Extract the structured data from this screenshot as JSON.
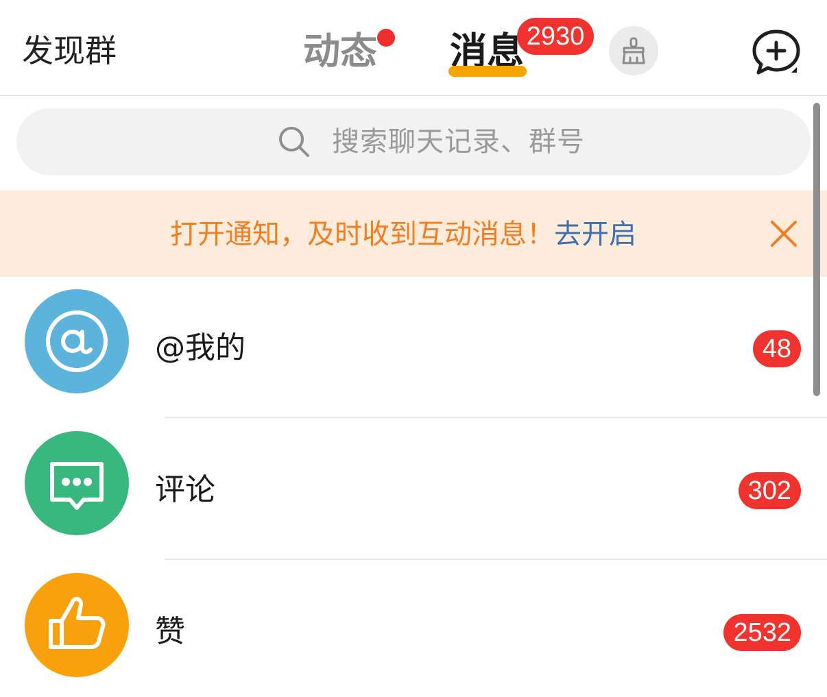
{
  "header": {
    "discover_group": "发现群",
    "tabs": [
      {
        "label": "动态",
        "has_dot": true
      },
      {
        "label": "消息",
        "active": true,
        "badge": "2930"
      }
    ],
    "clean_icon": "broom-icon",
    "new_chat_icon": "chat-plus-icon"
  },
  "search": {
    "placeholder": "搜索聊天记录、群号",
    "icon": "search-icon"
  },
  "banner": {
    "message": "打开通知，及时收到互动消息！",
    "link": "去开启",
    "close_icon": "close-icon"
  },
  "list": {
    "items": [
      {
        "label": "@我的",
        "badge": "48",
        "icon": "at-icon",
        "color": "#5cb3dc"
      },
      {
        "label": "评论",
        "badge": "302",
        "icon": "comment-icon",
        "color": "#38b77f"
      },
      {
        "label": "赞",
        "badge": "2532",
        "icon": "thumbs-up-icon",
        "color": "#f9a10c"
      }
    ]
  },
  "colors": {
    "accent": "#f5a400",
    "badge": "#f0332e",
    "banner_bg": "#fdebdc",
    "banner_text": "#f07f22",
    "banner_link": "#3d6fb3"
  }
}
